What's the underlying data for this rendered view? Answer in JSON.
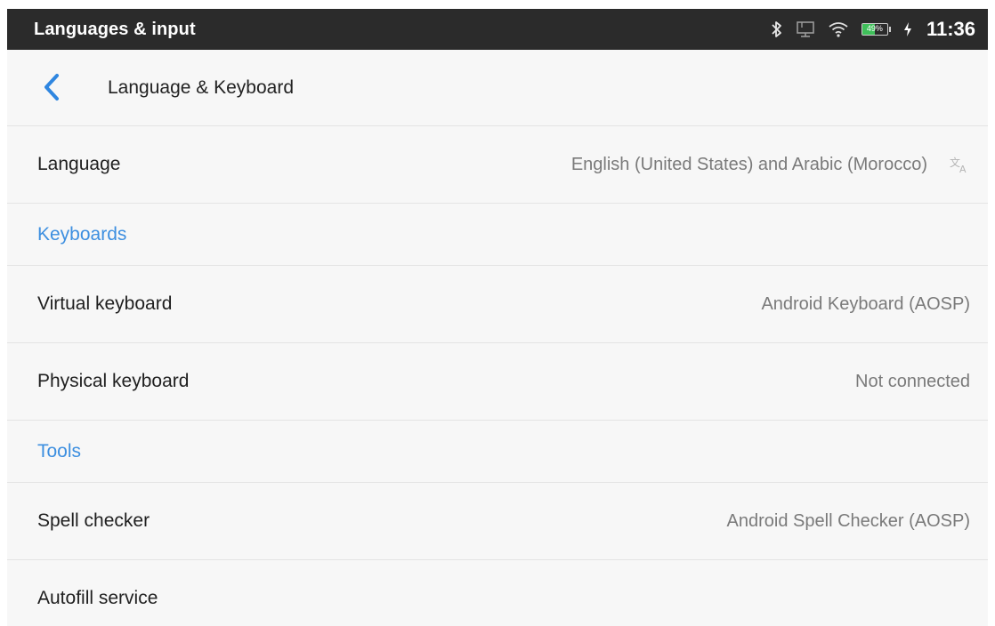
{
  "status_bar": {
    "title": "Languages & input",
    "battery_percent_label": "49%",
    "battery_level": 0.49,
    "time": "11:36",
    "icons": [
      "bluetooth-icon",
      "screen-cast-icon",
      "wifi-icon",
      "battery-icon",
      "charging-icon"
    ]
  },
  "app_bar": {
    "title": "Language & Keyboard",
    "back_icon": "chevron-left-icon"
  },
  "language_row": {
    "label": "Language",
    "value": "English (United States) and Arabic (Morocco)",
    "icon": "translate-icon"
  },
  "sections": {
    "keyboards_header": "Keyboards",
    "tools_header": "Tools"
  },
  "virtual_keyboard_row": {
    "label": "Virtual keyboard",
    "value": "Android Keyboard (AOSP)"
  },
  "physical_keyboard_row": {
    "label": "Physical keyboard",
    "value": "Not connected"
  },
  "spell_checker_row": {
    "label": "Spell checker",
    "value": "Android Spell Checker (AOSP)"
  },
  "autofill_row": {
    "label": "Autofill service"
  },
  "colors": {
    "accent": "#3d8fe0",
    "status_bar_bg": "#2b2b2b",
    "battery_green": "#3fbf5a",
    "background": "#f7f7f7"
  }
}
